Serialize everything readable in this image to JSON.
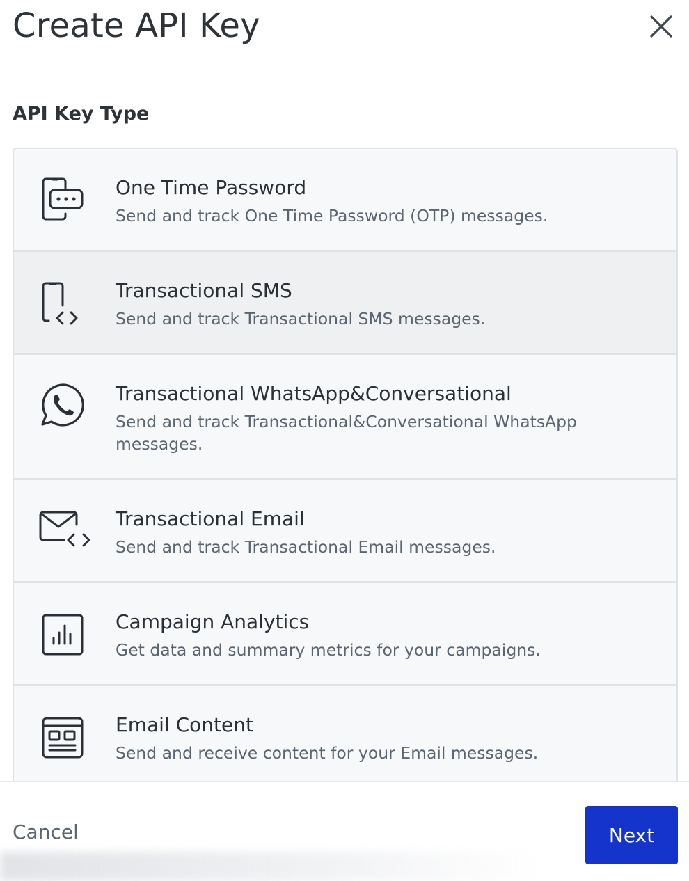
{
  "dialog": {
    "title": "Create API Key",
    "close_icon": "close-icon"
  },
  "section": {
    "label": "API Key Type"
  },
  "options": [
    {
      "title": "One Time Password",
      "description": "Send and track One Time Password (OTP) messages.",
      "icon": "otp-phone-icon"
    },
    {
      "title": "Transactional SMS",
      "description": "Send and track Transactional SMS messages.",
      "icon": "phone-code-icon",
      "selected": true
    },
    {
      "title": "Transactional WhatsApp&Conversational",
      "description": "Send and track Transactional&Conversational WhatsApp messages.",
      "icon": "whatsapp-icon"
    },
    {
      "title": "Transactional Email",
      "description": "Send and track Transactional Email messages.",
      "icon": "email-code-icon"
    },
    {
      "title": "Campaign Analytics",
      "description": "Get data and summary metrics for your campaigns.",
      "icon": "analytics-chart-icon"
    },
    {
      "title": "Email Content",
      "description": "Send and receive content for your Email messages.",
      "icon": "email-template-icon"
    }
  ],
  "footer": {
    "cancel_label": "Cancel",
    "next_label": "Next"
  },
  "colors": {
    "primary": "#1434cb",
    "selected_bg": "#eff0f2",
    "option_bg": "#f7f8fa",
    "border": "#dfe2e6"
  }
}
